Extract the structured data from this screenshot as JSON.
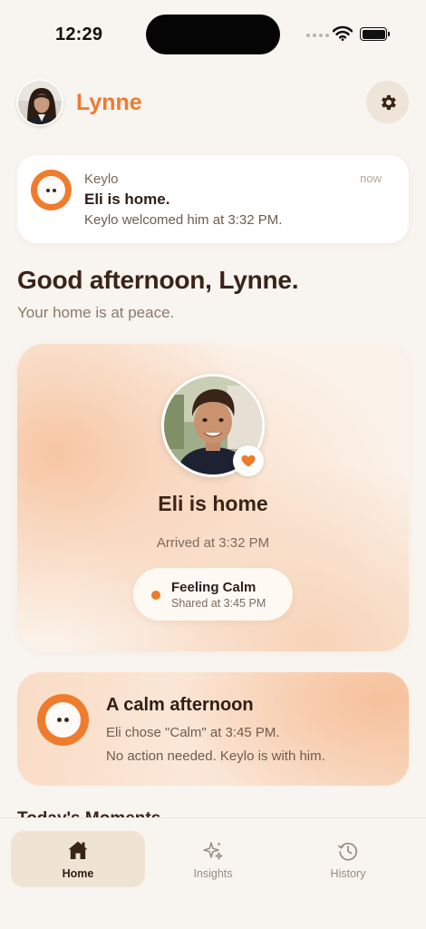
{
  "status_bar": {
    "time": "12:29"
  },
  "header": {
    "user_name": "Lynne"
  },
  "notification": {
    "app": "Keylo",
    "time": "now",
    "title": "Eli is home.",
    "body": "Keylo welcomed him at 3:32 PM."
  },
  "greeting": {
    "title": "Good afternoon, Lynne.",
    "subtitle": "Your home is at peace."
  },
  "presence": {
    "status": "Eli is home",
    "arrived": "Arrived at 3:32 PM",
    "mood": {
      "label": "Feeling Calm",
      "time": "Shared at 3:45 PM"
    }
  },
  "calm_card": {
    "title": "A calm afternoon",
    "line1": "Eli chose \"Calm\" at 3:45 PM.",
    "line2": "No action needed. Keylo is with him."
  },
  "section": {
    "heading": "Today's Moments"
  },
  "tabs": [
    {
      "label": "Home",
      "icon": "home-icon",
      "active": true
    },
    {
      "label": "Insights",
      "icon": "sparkles-icon",
      "active": false
    },
    {
      "label": "History",
      "icon": "history-icon",
      "active": false
    }
  ],
  "colors": {
    "accent": "#ef7a2c",
    "background": "#f8f4ef",
    "text": "#3a2418"
  }
}
